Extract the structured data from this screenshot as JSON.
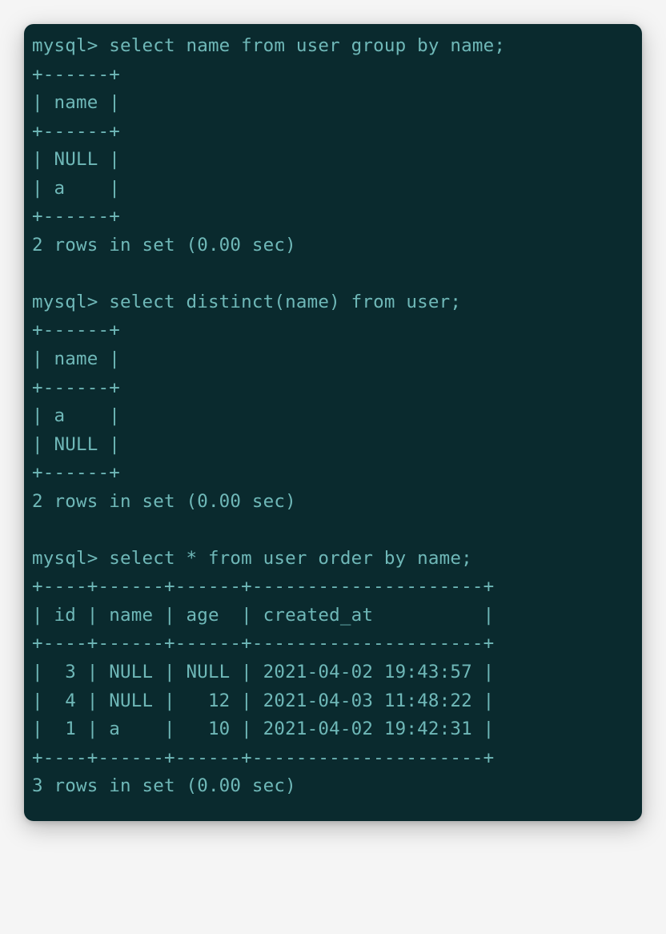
{
  "terminal": {
    "lines": [
      "mysql> select name from user group by name;",
      "+------+",
      "| name |",
      "+------+",
      "| NULL |",
      "| a    |",
      "+------+",
      "2 rows in set (0.00 sec)",
      "",
      "mysql> select distinct(name) from user;",
      "+------+",
      "| name |",
      "+------+",
      "| a    |",
      "| NULL |",
      "+------+",
      "2 rows in set (0.00 sec)",
      "",
      "mysql> select * from user order by name;",
      "+----+------+------+---------------------+",
      "| id | name | age  | created_at          |",
      "+----+------+------+---------------------+",
      "|  3 | NULL | NULL | 2021-04-02 19:43:57 |",
      "|  4 | NULL |   12 | 2021-04-03 11:48:22 |",
      "|  1 | a    |   10 | 2021-04-02 19:42:31 |",
      "+----+------+------+---------------------+",
      "3 rows in set (0.00 sec)"
    ]
  },
  "queries": [
    {
      "prompt": "mysql>",
      "command": "select name from user group by name;",
      "result_columns": [
        "name"
      ],
      "result_rows": [
        [
          "NULL"
        ],
        [
          "a"
        ]
      ],
      "status": "2 rows in set (0.00 sec)"
    },
    {
      "prompt": "mysql>",
      "command": "select distinct(name) from user;",
      "result_columns": [
        "name"
      ],
      "result_rows": [
        [
          "a"
        ],
        [
          "NULL"
        ]
      ],
      "status": "2 rows in set (0.00 sec)"
    },
    {
      "prompt": "mysql>",
      "command": "select * from user order by name;",
      "result_columns": [
        "id",
        "name",
        "age",
        "created_at"
      ],
      "result_rows": [
        [
          "3",
          "NULL",
          "NULL",
          "2021-04-02 19:43:57"
        ],
        [
          "4",
          "NULL",
          "12",
          "2021-04-03 11:48:22"
        ],
        [
          "1",
          "a",
          "10",
          "2021-04-02 19:42:31"
        ]
      ],
      "status": "3 rows in set (0.00 sec)"
    }
  ],
  "colors": {
    "background": "#0a2a2e",
    "text": "#6fb8b8"
  }
}
